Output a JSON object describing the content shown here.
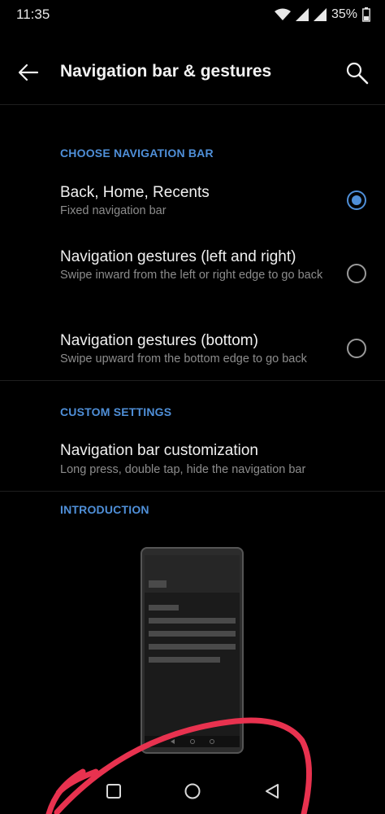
{
  "status": {
    "time": "11:35",
    "battery": "35%"
  },
  "header": {
    "title": "Navigation bar & gestures"
  },
  "sections": {
    "choose_nav": {
      "header": "CHOOSE NAVIGATION BAR",
      "options": [
        {
          "title": "Back, Home, Recents",
          "subtitle": "Fixed navigation bar",
          "selected": true
        },
        {
          "title": "Navigation gestures (left and right)",
          "subtitle": "Swipe inward from the left or right edge to go back",
          "selected": false
        },
        {
          "title": "Navigation gestures (bottom)",
          "subtitle": "Swipe upward from the bottom edge to go back",
          "selected": false
        }
      ]
    },
    "custom": {
      "header": "CUSTOM SETTINGS",
      "item": {
        "title": "Navigation bar customization",
        "subtitle": "Long press, double tap, hide the navigation bar"
      }
    },
    "intro": {
      "header": "INTRODUCTION"
    }
  },
  "colors": {
    "accent": "#4f8fd8",
    "background": "#000000",
    "scribble": "#e8324f"
  },
  "icons": {
    "back": "arrow-left-icon",
    "search": "search-icon",
    "recents": "square-icon",
    "home": "circle-icon",
    "nav_back": "triangle-left-icon"
  }
}
